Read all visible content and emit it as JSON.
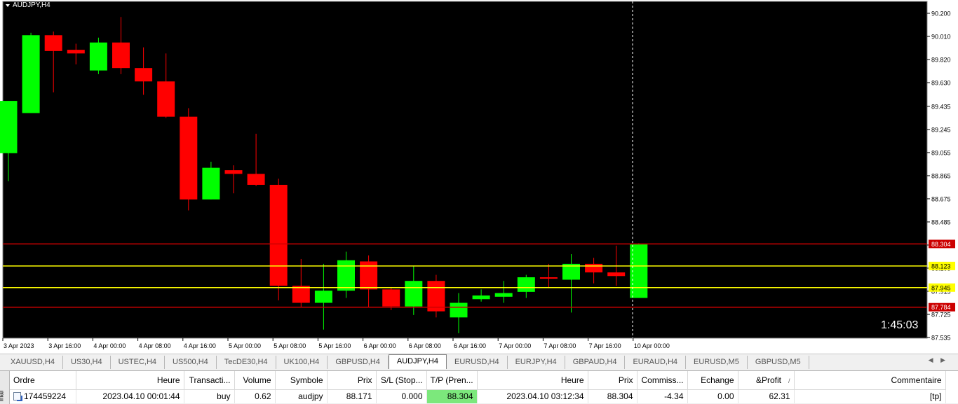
{
  "chart": {
    "symbol": "AUDJPY,H4",
    "timer": "1:45:03",
    "background": "#000000",
    "bull_color": "#00ff00",
    "bear_color": "#ff0000",
    "price_scale": [
      "90.200",
      "90.010",
      "89.820",
      "89.630",
      "89.435",
      "89.245",
      "89.055",
      "88.865",
      "88.675",
      "88.485",
      "88.295",
      "88.105",
      "87.915",
      "87.725",
      "87.535"
    ],
    "time_scale": [
      "3 Apr 2023",
      "3 Apr 16:00",
      "4 Apr 00:00",
      "4 Apr 08:00",
      "4 Apr 16:00",
      "5 Apr 00:00",
      "5 Apr 08:00",
      "5 Apr 16:00",
      "6 Apr 00:00",
      "6 Apr 08:00",
      "6 Apr 16:00",
      "7 Apr 00:00",
      "7 Apr 08:00",
      "7 Apr 16:00",
      "10 Apr 00:00"
    ],
    "hlines": [
      {
        "price": 88.304,
        "label": "88.304",
        "color": "#cc0000",
        "label_bg": "#cc0000",
        "label_fg": "#ffffff"
      },
      {
        "price": 88.123,
        "label": "88.123",
        "color": "#ffff00",
        "label_bg": "#ffff00",
        "label_fg": "#000000"
      },
      {
        "price": 87.945,
        "label": "87.945",
        "color": "#ffff00",
        "label_bg": "#ffff00",
        "label_fg": "#000000"
      },
      {
        "price": 87.784,
        "label": "87.784",
        "color": "#cc0000",
        "label_bg": "#cc0000",
        "label_fg": "#ffffff"
      }
    ],
    "candles": [
      {
        "o": 89.05,
        "h": 89.48,
        "l": 88.82,
        "c": 89.48
      },
      {
        "o": 89.38,
        "h": 90.04,
        "l": 89.38,
        "c": 90.02
      },
      {
        "o": 90.02,
        "h": 90.05,
        "l": 89.55,
        "c": 89.89
      },
      {
        "o": 89.9,
        "h": 89.95,
        "l": 89.78,
        "c": 89.87
      },
      {
        "o": 89.73,
        "h": 90.0,
        "l": 89.7,
        "c": 89.96
      },
      {
        "o": 89.96,
        "h": 90.17,
        "l": 89.7,
        "c": 89.75
      },
      {
        "o": 89.75,
        "h": 89.92,
        "l": 89.53,
        "c": 89.64
      },
      {
        "o": 89.64,
        "h": 89.87,
        "l": 89.34,
        "c": 89.35
      },
      {
        "o": 89.35,
        "h": 89.42,
        "l": 88.58,
        "c": 88.67
      },
      {
        "o": 88.67,
        "h": 88.98,
        "l": 88.67,
        "c": 88.93
      },
      {
        "o": 88.91,
        "h": 88.95,
        "l": 88.72,
        "c": 88.88
      },
      {
        "o": 88.88,
        "h": 89.21,
        "l": 88.78,
        "c": 88.79
      },
      {
        "o": 88.79,
        "h": 88.84,
        "l": 87.84,
        "c": 87.96
      },
      {
        "o": 87.96,
        "h": 88.18,
        "l": 87.78,
        "c": 87.82
      },
      {
        "o": 87.82,
        "h": 88.14,
        "l": 87.6,
        "c": 87.92
      },
      {
        "o": 87.92,
        "h": 88.24,
        "l": 87.86,
        "c": 88.17
      },
      {
        "o": 88.16,
        "h": 88.21,
        "l": 87.78,
        "c": 87.93
      },
      {
        "o": 87.93,
        "h": 87.95,
        "l": 87.76,
        "c": 87.79
      },
      {
        "o": 87.79,
        "h": 88.12,
        "l": 87.72,
        "c": 88.0
      },
      {
        "o": 88.0,
        "h": 88.05,
        "l": 87.7,
        "c": 87.75
      },
      {
        "o": 87.7,
        "h": 87.9,
        "l": 87.57,
        "c": 87.82
      },
      {
        "o": 87.85,
        "h": 87.93,
        "l": 87.83,
        "c": 87.88
      },
      {
        "o": 87.87,
        "h": 88.0,
        "l": 87.82,
        "c": 87.9
      },
      {
        "o": 87.91,
        "h": 88.05,
        "l": 87.86,
        "c": 88.03
      },
      {
        "o": 88.03,
        "h": 88.14,
        "l": 87.94,
        "c": 88.02
      },
      {
        "o": 88.01,
        "h": 88.22,
        "l": 87.74,
        "c": 88.14
      },
      {
        "o": 88.14,
        "h": 88.19,
        "l": 87.98,
        "c": 88.07
      },
      {
        "o": 88.07,
        "h": 88.29,
        "l": 87.96,
        "c": 88.04
      },
      {
        "o": 87.86,
        "h": 88.31,
        "l": 87.86,
        "c": 88.3
      }
    ]
  },
  "tabs": [
    "XAUUSD,H4",
    "US30,H4",
    "USTEC,H4",
    "US500,H4",
    "TecDE30,H4",
    "UK100,H4",
    "GBPUSD,H4",
    "AUDJPY,H4",
    "EURUSD,H4",
    "EURJPY,H4",
    "GBPAUD,H4",
    "EURAUD,H4",
    "EURUSD,M5",
    "GBPUSD,M5"
  ],
  "active_tab": "AUDJPY,H4",
  "terminal": {
    "side_label": "inal",
    "headers": [
      "Ordre",
      "Heure",
      "Transacti...",
      "Volume",
      "Symbole",
      "Prix",
      "S/L (Stop...",
      "T/P (Pren...",
      "Heure",
      "Prix",
      "Commiss...",
      "Echange",
      "&Profit",
      "Commentaire"
    ],
    "sort_indicator": "/",
    "row": [
      "174459224",
      "2023.04.10 00:01:44",
      "buy",
      "0.62",
      "audjpy",
      "88.171",
      "0.000",
      "88.304",
      "2023.04.10 03:12:34",
      "88.304",
      "-4.34",
      "0.00",
      "62.31",
      "[tp]"
    ]
  }
}
